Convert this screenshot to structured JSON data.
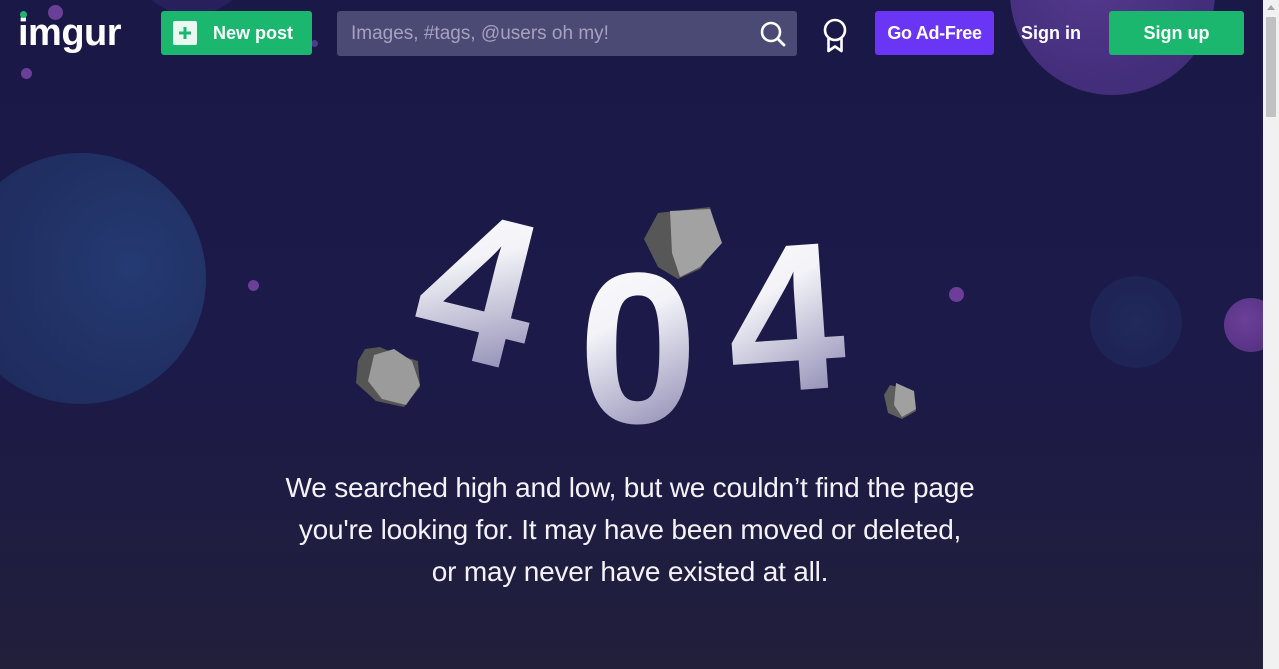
{
  "header": {
    "logo": "imgur",
    "new_post_label": "New post",
    "search_placeholder": "Images, #tags, @users oh my!",
    "ad_free_label": "Go Ad-Free",
    "sign_in_label": "Sign in",
    "sign_up_label": "Sign up"
  },
  "error": {
    "code": "404",
    "message_lines": [
      "We searched high and low, but we couldn’t find the page",
      "you're looking for. It may have been moved or deleted,",
      "or may never have existed at all."
    ]
  },
  "colors": {
    "background": "#1a1846",
    "brand_green": "#1bb76e",
    "ad_free_purple": "#6a35f5",
    "search_bg": "#4b4a74",
    "planet_purple": "#6a3f97"
  },
  "icons": {
    "new_post": "plus-icon",
    "search": "search-icon",
    "awards": "award-ribbon-icon"
  }
}
